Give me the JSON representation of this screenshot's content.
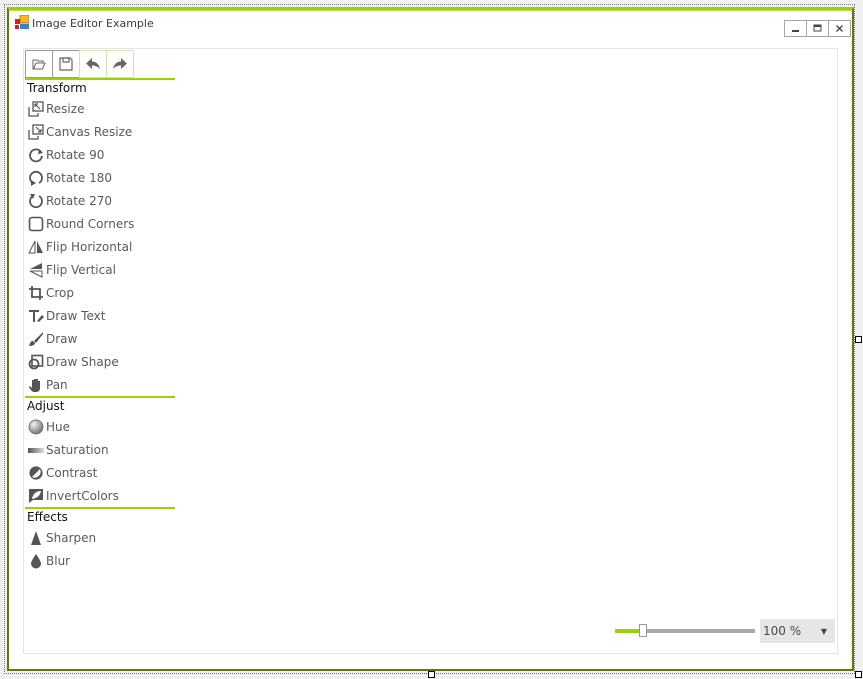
{
  "window": {
    "title": "Image Editor Example",
    "controls": {
      "minimize": "minimize",
      "maximize": "maximize",
      "close": "close"
    }
  },
  "toolbar": {
    "buttons": [
      {
        "name": "open",
        "icon": "folder-open-icon"
      },
      {
        "name": "save",
        "icon": "save-icon"
      },
      {
        "name": "undo",
        "icon": "undo-icon"
      },
      {
        "name": "redo",
        "icon": "redo-icon"
      }
    ]
  },
  "groups": {
    "transform": {
      "label": "Transform",
      "items": [
        {
          "label": "Resize",
          "icon": "resize-icon"
        },
        {
          "label": "Canvas Resize",
          "icon": "canvas-resize-icon"
        },
        {
          "label": "Rotate 90",
          "icon": "rotate-90-icon"
        },
        {
          "label": "Rotate 180",
          "icon": "rotate-180-icon"
        },
        {
          "label": "Rotate 270",
          "icon": "rotate-270-icon"
        },
        {
          "label": "Round Corners",
          "icon": "round-corners-icon"
        },
        {
          "label": "Flip Horizontal",
          "icon": "flip-horizontal-icon"
        },
        {
          "label": "Flip Vertical",
          "icon": "flip-vertical-icon"
        },
        {
          "label": "Crop",
          "icon": "crop-icon"
        },
        {
          "label": "Draw Text",
          "icon": "draw-text-icon"
        },
        {
          "label": "Draw",
          "icon": "draw-icon"
        },
        {
          "label": "Draw Shape",
          "icon": "draw-shape-icon"
        },
        {
          "label": "Pan",
          "icon": "pan-icon"
        }
      ]
    },
    "adjust": {
      "label": "Adjust",
      "items": [
        {
          "label": "Hue",
          "icon": "hue-icon"
        },
        {
          "label": "Saturation",
          "icon": "saturation-icon"
        },
        {
          "label": "Contrast",
          "icon": "contrast-icon"
        },
        {
          "label": "InvertColors",
          "icon": "invert-colors-icon"
        }
      ]
    },
    "effects": {
      "label": "Effects",
      "items": [
        {
          "label": "Sharpen",
          "icon": "sharpen-icon"
        },
        {
          "label": "Blur",
          "icon": "blur-icon"
        }
      ]
    }
  },
  "zoom": {
    "value_label": "100 %",
    "slider_fraction": 0.2
  },
  "colors": {
    "accent": "#9bd10a",
    "frame_dark": "#5d7a10",
    "icon_gray": "#5a5a5a"
  }
}
